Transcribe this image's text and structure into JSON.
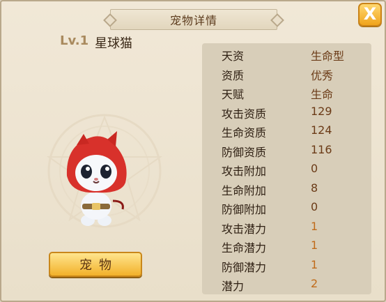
{
  "title": "宠物详情",
  "close_label": "X",
  "pet": {
    "level": "Lv.1",
    "name": "星球猫"
  },
  "pet_button": "宠物",
  "stats": [
    {
      "label": "天资",
      "value": "生命型"
    },
    {
      "label": "资质",
      "value": "优秀"
    },
    {
      "label": "天赋",
      "value": "生命"
    },
    {
      "label": "攻击资质",
      "value": "129"
    },
    {
      "label": "生命资质",
      "value": "124"
    },
    {
      "label": "防御资质",
      "value": "116"
    },
    {
      "label": "攻击附加",
      "value": "0"
    },
    {
      "label": "生命附加",
      "value": "8"
    },
    {
      "label": "防御附加",
      "value": "0"
    },
    {
      "label": "攻击潜力",
      "value": "1"
    },
    {
      "label": "生命潜力",
      "value": "1"
    },
    {
      "label": "防御潜力",
      "value": "1"
    },
    {
      "label": "潜力",
      "value": "2"
    }
  ]
}
